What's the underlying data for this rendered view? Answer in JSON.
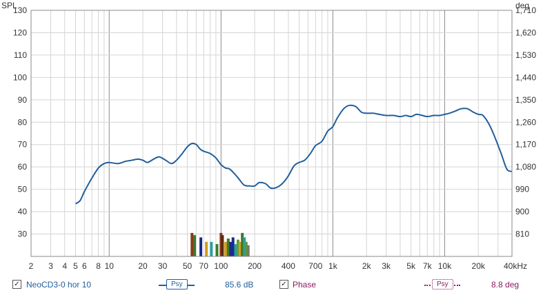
{
  "chart_data": {
    "type": "line",
    "x_scale": "log",
    "xlim": [
      2,
      40000
    ],
    "ylim": [
      20,
      130
    ],
    "y2lim": [
      720,
      1710
    ],
    "left_axis_title": "SPL",
    "right_axis_title": "deg",
    "x_tick_labels": [
      {
        "x": 2,
        "label": "2"
      },
      {
        "x": 3,
        "label": "3"
      },
      {
        "x": 4,
        "label": "4"
      },
      {
        "x": 5,
        "label": "5"
      },
      {
        "x": 6,
        "label": "6"
      },
      {
        "x": 8,
        "label": "8"
      },
      {
        "x": 10,
        "label": "10"
      },
      {
        "x": 20,
        "label": "20"
      },
      {
        "x": 30,
        "label": "30"
      },
      {
        "x": 50,
        "label": "50"
      },
      {
        "x": 70,
        "label": "70"
      },
      {
        "x": 100,
        "label": "100"
      },
      {
        "x": 200,
        "label": "200"
      },
      {
        "x": 400,
        "label": "400"
      },
      {
        "x": 700,
        "label": "700"
      },
      {
        "x": 1000,
        "label": "1k"
      },
      {
        "x": 2000,
        "label": "2k"
      },
      {
        "x": 3000,
        "label": "3k"
      },
      {
        "x": 5000,
        "label": "5k"
      },
      {
        "x": 7000,
        "label": "7k"
      },
      {
        "x": 10000,
        "label": "10k"
      },
      {
        "x": 20000,
        "label": "20k"
      },
      {
        "x": 40000,
        "label": "40kHz"
      }
    ],
    "y_ticks_left": [
      {
        "v": 130,
        "label": "130"
      },
      {
        "v": 120,
        "label": "120"
      },
      {
        "v": 110,
        "label": "110"
      },
      {
        "v": 100,
        "label": "100"
      },
      {
        "v": 90,
        "label": "90"
      },
      {
        "v": 80,
        "label": "80"
      },
      {
        "v": 70,
        "label": "70"
      },
      {
        "v": 60,
        "label": "60"
      },
      {
        "v": 50,
        "label": "50"
      },
      {
        "v": 40,
        "label": "40"
      },
      {
        "v": 30,
        "label": "30"
      }
    ],
    "y_ticks_right": [
      {
        "v": 1710,
        "label": "1,710"
      },
      {
        "v": 1620,
        "label": "1,620"
      },
      {
        "v": 1530,
        "label": "1,530"
      },
      {
        "v": 1440,
        "label": "1,440"
      },
      {
        "v": 1350,
        "label": "1,350"
      },
      {
        "v": 1260,
        "label": "1,260"
      },
      {
        "v": 1170,
        "label": "1,170"
      },
      {
        "v": 1080,
        "label": "1,080"
      },
      {
        "v": 990,
        "label": "990"
      },
      {
        "v": 900,
        "label": "900"
      },
      {
        "v": 810,
        "label": "810"
      }
    ],
    "grid": true,
    "series": [
      {
        "name": "NeoCD3-0 hor 10",
        "color": "#1f5e9c",
        "x": [
          5,
          5.5,
          6,
          7,
          8,
          9,
          10,
          12,
          14,
          16,
          18,
          20,
          22,
          25,
          28,
          32,
          36,
          40,
          45,
          50,
          55,
          60,
          65,
          70,
          80,
          90,
          100,
          110,
          120,
          140,
          160,
          180,
          200,
          220,
          250,
          280,
          320,
          360,
          400,
          450,
          500,
          560,
          630,
          700,
          800,
          900,
          1000,
          1100,
          1250,
          1400,
          1600,
          1800,
          2000,
          2300,
          2600,
          3000,
          3500,
          4000,
          4500,
          5000,
          5600,
          6300,
          7000,
          8000,
          9000,
          10000,
          11000,
          12500,
          14000,
          16000,
          18000,
          20000,
          22000,
          25000,
          28000,
          32000,
          36000,
          40000
        ],
        "y": [
          43.5,
          45,
          49,
          55,
          59.5,
          61.5,
          62,
          61.5,
          62.5,
          63,
          63.5,
          63,
          62,
          63.5,
          64.5,
          63,
          61.5,
          63,
          66,
          69,
          70.5,
          70,
          68,
          67,
          66,
          64,
          61,
          59.5,
          59,
          55.5,
          52,
          51.5,
          51.5,
          53,
          52.5,
          50.5,
          51,
          53,
          56,
          60.5,
          62,
          63,
          66,
          69.5,
          71.5,
          76,
          78,
          82,
          86,
          87.5,
          87,
          84.5,
          84,
          84,
          83.5,
          83,
          83,
          82.5,
          83,
          82.5,
          83.5,
          83,
          82.5,
          83,
          83,
          83.5,
          84,
          85,
          86,
          86,
          84.5,
          83.5,
          83,
          79,
          73.5,
          66,
          59,
          58
        ]
      }
    ],
    "minimum_phase_bars": {
      "x": [
        55,
        58,
        66,
        74,
        82,
        92,
        100,
        103,
        110,
        116,
        122,
        128,
        135,
        142,
        148,
        155,
        162,
        168,
        175
      ],
      "y": [
        30.5,
        29.5,
        28.5,
        26.5,
        26.5,
        25.5,
        30.5,
        29.5,
        26.5,
        28,
        26.5,
        28.5,
        25.5,
        27.5,
        26.5,
        30.5,
        28.5,
        26.5,
        25
      ],
      "colors": [
        "#8c3a1c",
        "#3a7a2a",
        "#1c2a8c",
        "#d99a1a",
        "#2aa0a0",
        "#3a7a2a",
        "#8c3a1c",
        "#5a2a1a",
        "#d99a1a",
        "#3a7a2a",
        "#1c2a8c",
        "#1c2a8c",
        "#2aa0a0",
        "#5c9c3c",
        "#d99a1a",
        "#3a7a2a",
        "#2aa0a0",
        "#5c9c3c",
        "#7a7a5a"
      ]
    }
  },
  "legend": {
    "series_label": "NeoCD3-0 hor 10",
    "series_checked": "✓",
    "series_psy": "Psy",
    "series_value": "85.6 dB",
    "phase_label": "Phase",
    "phase_checked": "✓",
    "phase_psy": "Psy",
    "phase_value": "8.8 deg",
    "series_color": "#1f5e9c",
    "phase_color": "#8a1a5e"
  }
}
